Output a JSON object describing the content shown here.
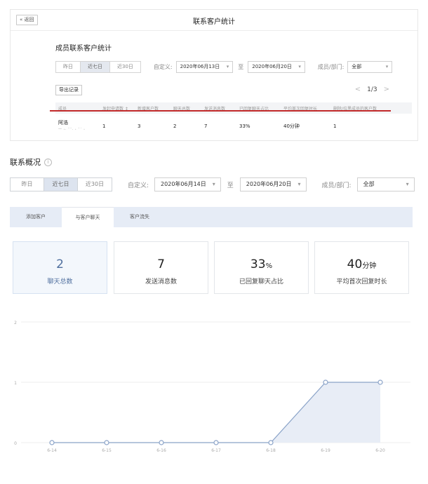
{
  "top_panel": {
    "back_label": "« 返回",
    "title": "联系客户统计",
    "section_title": "成员联系客户统计",
    "ranges": [
      "昨日",
      "近七日",
      "近30日"
    ],
    "custom_label": "自定义:",
    "date_from": "2020年06月13日",
    "to_label": "至",
    "date_to": "2020年06月20日",
    "member_label": "成员/部门:",
    "member_value": "全部",
    "export_label": "导出记录",
    "page_info": "1/3",
    "prev_icon": "chevron-left-icon",
    "next_icon": "chevron-right-icon",
    "columns": [
      "成员",
      "发起申请数 ↕",
      "新增客户数",
      "聊天总数",
      "发送消息数",
      "已回复聊天占比",
      "平均首次回复时长",
      "删除/拉黑成员的客户数"
    ],
    "rows": [
      {
        "name": "阿浩",
        "sub": "一 ꞏ· ˉˉ· ꞏ ˉ˙ ꞏ",
        "values": [
          "1",
          "3",
          "2",
          "7",
          "33%",
          "40分钟",
          "1"
        ]
      }
    ],
    "highlight_color": "#c22a2a"
  },
  "overview": {
    "title": "联系概况",
    "info_icon": "ⓘ",
    "ranges": [
      "昨日",
      "近七日",
      "近30日"
    ],
    "custom_label": "自定义:",
    "date_from": "2020年06月14日",
    "to_label": "至",
    "date_to": "2020年06月20日",
    "member_label": "成员/部门:",
    "member_value": "全部",
    "tabs": [
      "添加客户",
      "与客户聊天",
      "客户流失"
    ],
    "stats": [
      {
        "value": "2",
        "unit": "",
        "label": "聊天总数"
      },
      {
        "value": "7",
        "unit": "",
        "label": "发送消息数"
      },
      {
        "value": "33",
        "unit": "%",
        "label": "已回复聊天占比"
      },
      {
        "value": "40",
        "unit": "分钟",
        "label": "平均首次回复时长"
      }
    ],
    "accent_color": "#4f6f9e"
  },
  "chart_data": {
    "type": "area",
    "categories": [
      "6-14",
      "6-15",
      "6-16",
      "6-17",
      "6-18",
      "6-19",
      "6-20"
    ],
    "values": [
      0,
      0,
      0,
      0,
      0,
      1,
      1
    ],
    "y_ticks": [
      "0",
      "1",
      "2"
    ],
    "ylim": [
      0,
      2
    ],
    "grid": true,
    "line_color": "#8aa3c8",
    "fill_color": "#e8edf6"
  }
}
